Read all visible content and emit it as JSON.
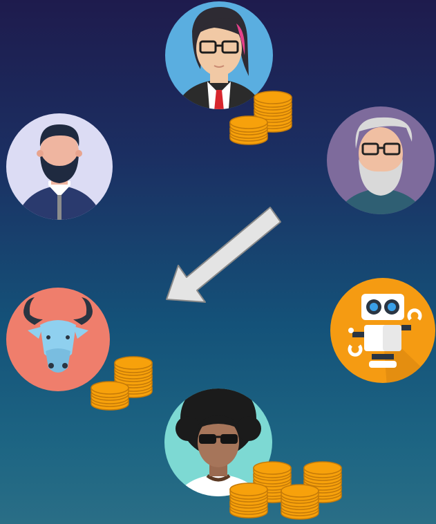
{
  "diagram": {
    "nodes": [
      {
        "id": "woman-glasses",
        "icon": "woman-avatar-icon",
        "bg": "#5aaee0",
        "coins": 2
      },
      {
        "id": "bearded-man",
        "icon": "bearded-man-avatar-icon",
        "bg": "#dcdcf4",
        "coins": 0
      },
      {
        "id": "old-man",
        "icon": "old-man-avatar-icon",
        "bg": "#7e6b9c",
        "coins": 0
      },
      {
        "id": "gnu",
        "icon": "gnu-avatar-icon",
        "bg": "#ef7e6c",
        "coins": 2
      },
      {
        "id": "robot",
        "icon": "robot-avatar-icon",
        "bg": "#f59b12",
        "coins": 0
      },
      {
        "id": "afro-person",
        "icon": "afro-person-avatar-icon",
        "bg": "#7dd9d3",
        "coins": 4
      }
    ],
    "arrow": {
      "icon": "transfer-arrow-icon",
      "from": "old-man",
      "to": "gnu"
    },
    "colors": {
      "coin": "#f7a10b",
      "coin_line": "#c57a08",
      "arrow": "#e4e4e4",
      "arrow_outline": "#8a8a8a"
    }
  }
}
